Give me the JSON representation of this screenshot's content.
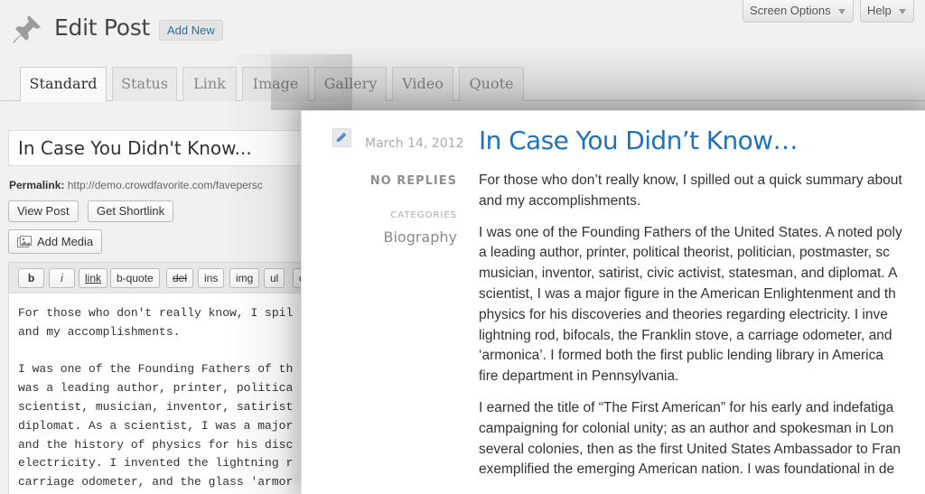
{
  "header": {
    "title": "Edit Post",
    "add_new": "Add New",
    "screen_options": "Screen Options",
    "help": "Help"
  },
  "tabs": [
    "Standard",
    "Status",
    "Link",
    "Image",
    "Gallery",
    "Video",
    "Quote"
  ],
  "post": {
    "title": "In Case You Didn't Know...",
    "permalink_label": "Permalink:",
    "permalink_url": "http://demo.crowdfavorite.com/favepersc",
    "view_post": "View Post",
    "get_shortlink": "Get Shortlink",
    "add_media": "Add Media"
  },
  "quicktags": [
    "b",
    "i",
    "link",
    "b-quote",
    "del",
    "ins",
    "img",
    "ul",
    "c"
  ],
  "content_lines": [
    "For those who don't really know, I spil",
    "and my accomplishments.",
    "",
    "I was one of the Founding Fathers of th",
    "was a leading author, printer, politica",
    "scientist, musician, inventor, satirist",
    "diplomat. As a scientist, I was a major",
    "and the history of physics for his disc",
    "electricity. I invented the lightning r",
    "carriage odometer, and the glass 'armor"
  ],
  "preview": {
    "date": "March 14, 2012",
    "replies": "NO REPLIES",
    "categories_label": "CATEGORIES",
    "category": "Biography",
    "title": "In Case You Didn’t Know…",
    "paragraphs": [
      [
        "For those who don’t really know, I spilled out a quick summary about",
        "and my accomplishments."
      ],
      [
        "I was one of the Founding Fathers of the United States. A noted poly",
        "a leading author, printer, political theorist, politician, postmaster, sc",
        "musician, inventor, satirist, civic activist, statesman, and diplomat. A",
        "scientist, I was a major figure in the American Enlightenment and th",
        "physics for his discoveries and theories regarding electricity. I inve",
        "lightning rod, bifocals, the Franklin stove, a carriage odometer, and",
        "‘armonica’. I formed both the first public lending library in America",
        "fire department in Pennsylvania."
      ],
      [
        "I earned the title of “The First American” for his early and indefatiga",
        "campaigning for colonial unity; as an author and spokesman in Lon",
        "several colonies, then as the first United States Ambassador to Fran",
        "exemplified the emerging American nation. I was foundational in de"
      ]
    ]
  },
  "colors": {
    "link_blue": "#21759b",
    "preview_title": "#1e73be"
  }
}
